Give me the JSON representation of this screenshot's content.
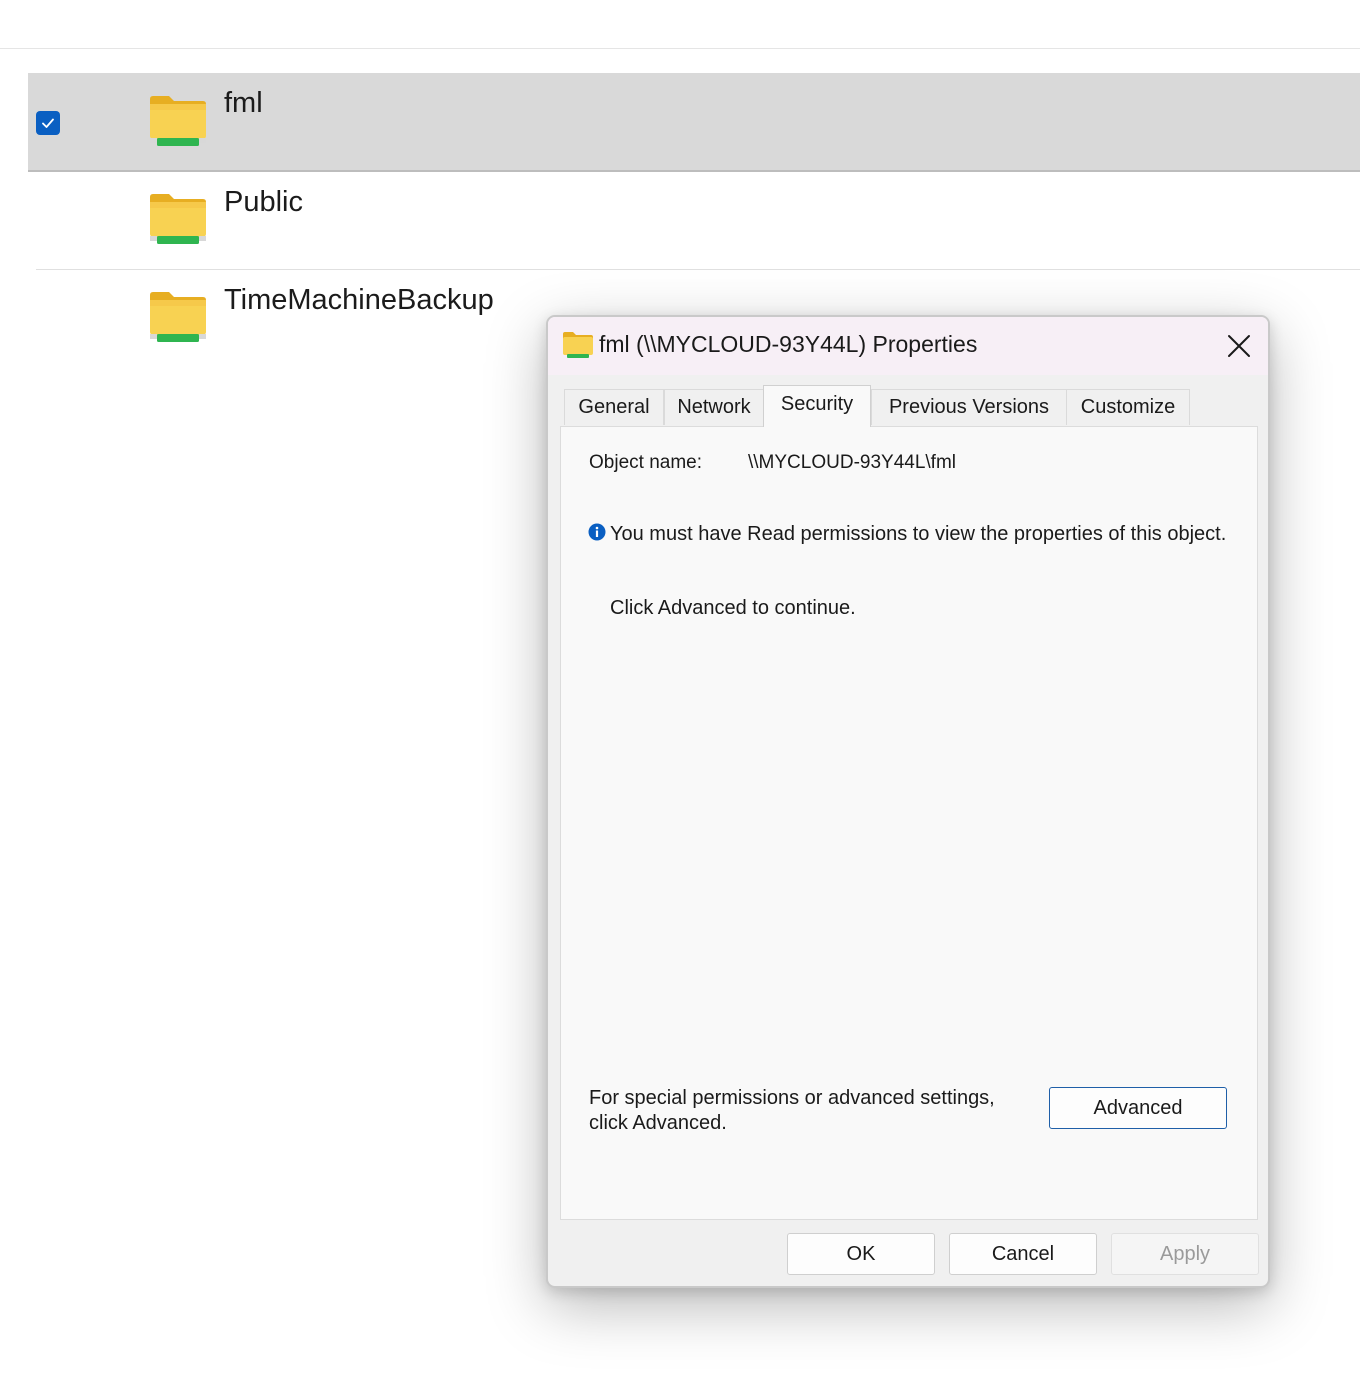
{
  "file_list": {
    "items": [
      {
        "name": "fml",
        "selected": true
      },
      {
        "name": "Public",
        "selected": false
      },
      {
        "name": "TimeMachineBackup",
        "selected": false
      }
    ]
  },
  "dialog": {
    "title": "fml (\\\\MYCLOUD-93Y44L) Properties",
    "tabs": [
      "General",
      "Network",
      "Security",
      "Previous Versions",
      "Customize"
    ],
    "active_tab": "Security",
    "object_name_label": "Object name:",
    "object_name_value": "\\\\MYCLOUD-93Y44L\\fml",
    "info_message": "You must have Read permissions to view the properties of this object.",
    "info_hint": "Click Advanced to continue.",
    "advanced_text": "For special permissions or advanced settings, click Advanced.",
    "advanced_button": "Advanced",
    "ok_button": "OK",
    "cancel_button": "Cancel",
    "apply_button": "Apply",
    "apply_enabled": false
  },
  "colors": {
    "accent": "#0a5fc2",
    "folder": "#f6c94a",
    "network_bar": "#35c05a",
    "selected_row": "#d9d9d9"
  },
  "icons": {
    "folder": "network-folder-icon",
    "checkbox": "checkbox-checked-icon",
    "close": "close-icon",
    "info": "info-icon"
  }
}
